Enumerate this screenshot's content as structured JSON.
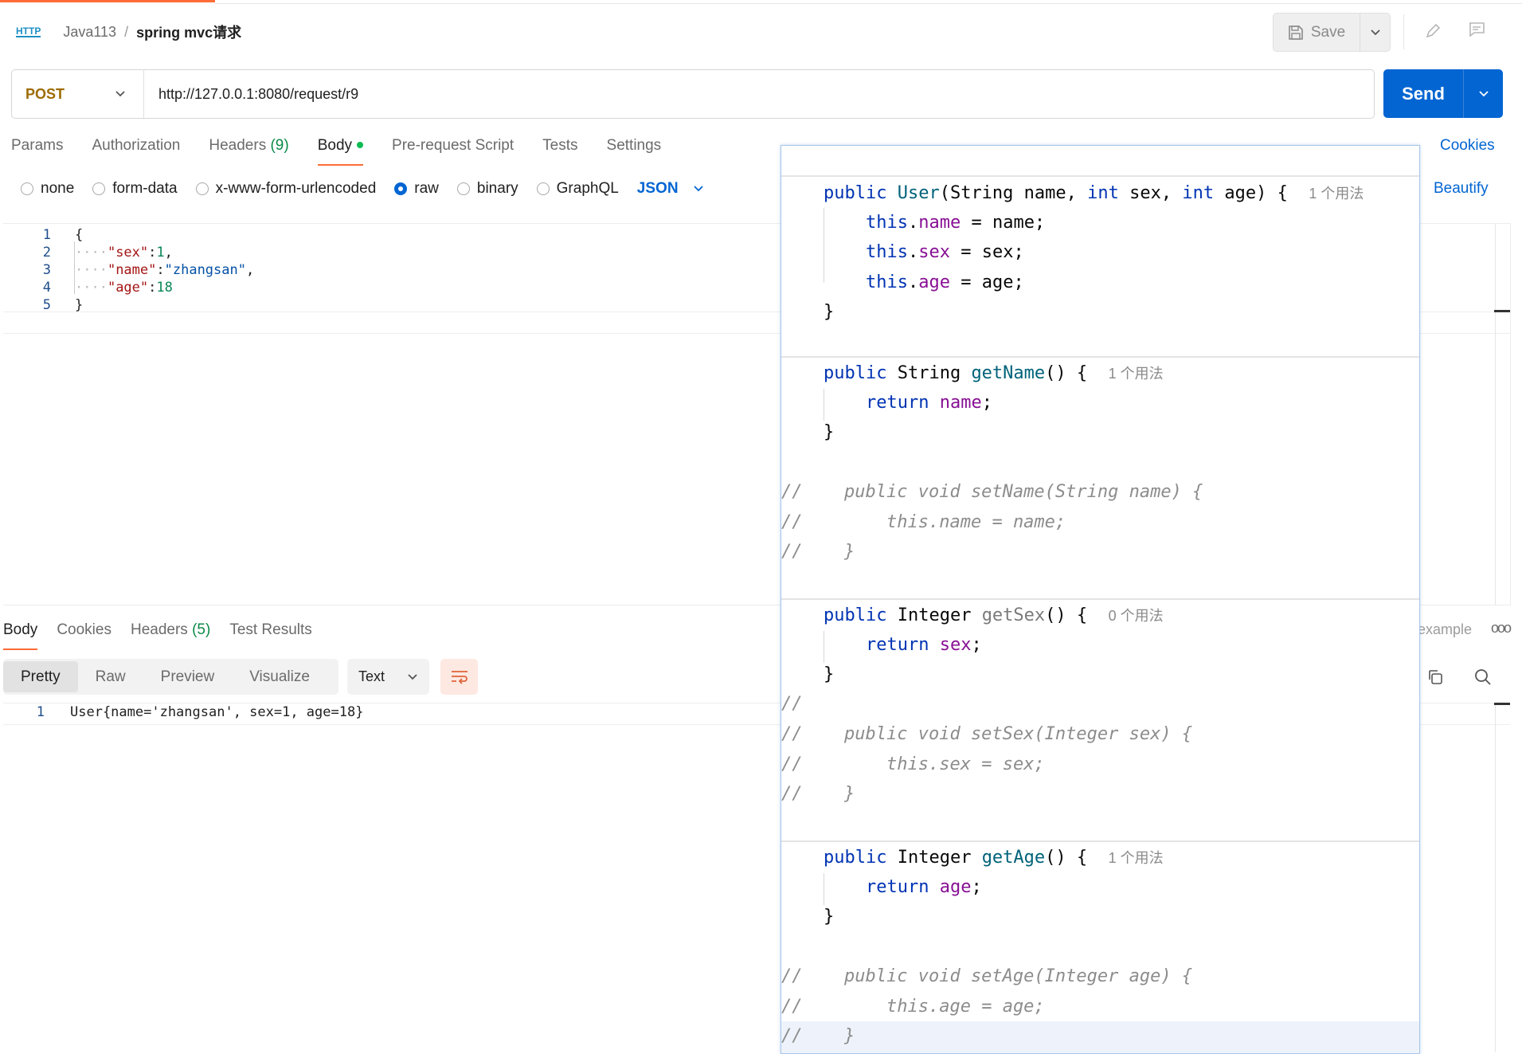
{
  "header": {
    "http_icon": "HTTP",
    "collection": "Java113",
    "separator": "/",
    "request_name": "spring mvc请求",
    "save_label": "Save"
  },
  "request": {
    "method": "POST",
    "url": "http://127.0.0.1:8080/request/r9",
    "send_label": "Send"
  },
  "request_tabs": {
    "params": "Params",
    "authorization": "Authorization",
    "headers": "Headers",
    "headers_count": "(9)",
    "body": "Body",
    "pre_request": "Pre-request Script",
    "tests": "Tests",
    "settings": "Settings",
    "cookies": "Cookies"
  },
  "body_types": {
    "none": "none",
    "form_data": "form-data",
    "urlencoded": "x-www-form-urlencoded",
    "raw": "raw",
    "binary": "binary",
    "graphql": "GraphQL",
    "format": "JSON",
    "beautify": "Beautify",
    "selected": "raw"
  },
  "request_body": {
    "line_numbers": [
      "1",
      "2",
      "3",
      "4",
      "5"
    ],
    "lines": {
      "l1": "{",
      "l2_key": "\"sex\"",
      "l2_val": "1",
      "l3_key": "\"name\"",
      "l3_val": "\"zhangsan\"",
      "l4_key": "\"age\"",
      "l4_val": "18",
      "l5": "}"
    }
  },
  "response": {
    "tabs": {
      "body": "Body",
      "cookies": "Cookies",
      "headers": "Headers",
      "headers_count": "(5)",
      "test_results": "Test Results",
      "example": "example"
    },
    "views": {
      "pretty": "Pretty",
      "raw": "Raw",
      "preview": "Preview",
      "visualize": "Visualize",
      "format": "Text"
    },
    "line_number": "1",
    "body_text": "User{name='zhangsan', sex=1, age=18}"
  },
  "code_popup": {
    "ctor_sig_a": "public ",
    "ctor_name": "User",
    "ctor_sig_b": "(String name, ",
    "ctor_int1": "int",
    "ctor_sig_c": " sex, ",
    "ctor_int2": "int",
    "ctor_sig_d": " age) {",
    "hint_1usage": "1 个用法",
    "hint_0usage": "0 个用法",
    "this_kw": "this",
    "name_fld": "name",
    "sex_fld": "sex",
    "age_fld": "age",
    "assign_name": " = name;",
    "assign_sex": " = sex;",
    "assign_age": " = age;",
    "close_brace": "}",
    "public_kw": "public ",
    "type_string": "String ",
    "type_integer": "Integer ",
    "get_name": "getName",
    "get_sex": "getSex",
    "get_age": "getAge",
    "open_sig": "() {",
    "return_kw": "return ",
    "semicolon": ";",
    "comment_prefix": "//",
    "cmt_set_name": "public void setName(String name) {",
    "cmt_this_name": "this.name = name;",
    "cmt_set_sex": "public void setSex(Integer sex) {",
    "cmt_this_sex": "this.sex = sex;",
    "cmt_set_age": "public void setAge(Integer age) {",
    "cmt_this_age": "this.age = age;",
    "cmt_close": "}"
  },
  "colors": {
    "accent_orange": "#ff6c37",
    "primary_blue": "#0265d2",
    "method_post": "#9d6b00"
  }
}
